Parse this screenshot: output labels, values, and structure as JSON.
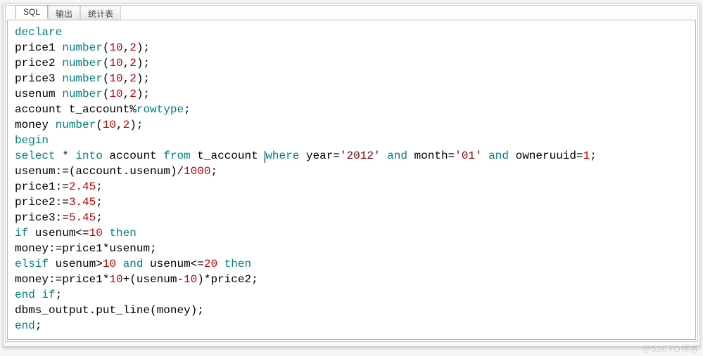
{
  "tabs": [
    {
      "label": "SQL",
      "active": true
    },
    {
      "label": "输出",
      "active": false
    },
    {
      "label": "统计表",
      "active": false
    }
  ],
  "code_tokens": [
    [
      {
        "t": "declare",
        "c": "kw"
      }
    ],
    [
      {
        "t": "price1 ",
        "c": "id"
      },
      {
        "t": "number",
        "c": "ty"
      },
      {
        "t": "(",
        "c": "punc"
      },
      {
        "t": "10",
        "c": "num"
      },
      {
        "t": ",",
        "c": "punc"
      },
      {
        "t": "2",
        "c": "num"
      },
      {
        "t": ");",
        "c": "punc"
      }
    ],
    [
      {
        "t": "price2 ",
        "c": "id"
      },
      {
        "t": "number",
        "c": "ty"
      },
      {
        "t": "(",
        "c": "punc"
      },
      {
        "t": "10",
        "c": "num"
      },
      {
        "t": ",",
        "c": "punc"
      },
      {
        "t": "2",
        "c": "num"
      },
      {
        "t": ");",
        "c": "punc"
      }
    ],
    [
      {
        "t": "price3 ",
        "c": "id"
      },
      {
        "t": "number",
        "c": "ty"
      },
      {
        "t": "(",
        "c": "punc"
      },
      {
        "t": "10",
        "c": "num"
      },
      {
        "t": ",",
        "c": "punc"
      },
      {
        "t": "2",
        "c": "num"
      },
      {
        "t": ");",
        "c": "punc"
      }
    ],
    [
      {
        "t": "usenum ",
        "c": "id"
      },
      {
        "t": "number",
        "c": "ty"
      },
      {
        "t": "(",
        "c": "punc"
      },
      {
        "t": "10",
        "c": "num"
      },
      {
        "t": ",",
        "c": "punc"
      },
      {
        "t": "2",
        "c": "num"
      },
      {
        "t": ");",
        "c": "punc"
      }
    ],
    [
      {
        "t": "account ",
        "c": "id"
      },
      {
        "t": "t_account",
        "c": "id"
      },
      {
        "t": "%",
        "c": "op"
      },
      {
        "t": "rowtype",
        "c": "ty"
      },
      {
        "t": ";",
        "c": "punc"
      }
    ],
    [
      {
        "t": "money ",
        "c": "id"
      },
      {
        "t": "number",
        "c": "ty"
      },
      {
        "t": "(",
        "c": "punc"
      },
      {
        "t": "10",
        "c": "num"
      },
      {
        "t": ",",
        "c": "punc"
      },
      {
        "t": "2",
        "c": "num"
      },
      {
        "t": ");",
        "c": "punc"
      }
    ],
    [
      {
        "t": "begin",
        "c": "kw"
      }
    ],
    [
      {
        "t": "select",
        "c": "kw"
      },
      {
        "t": " * ",
        "c": "id"
      },
      {
        "t": "into",
        "c": "kw"
      },
      {
        "t": " account ",
        "c": "id"
      },
      {
        "t": "from",
        "c": "kw"
      },
      {
        "t": " t_account ",
        "c": "id"
      },
      {
        "cursor": true
      },
      {
        "t": "where",
        "c": "kw"
      },
      {
        "t": " year=",
        "c": "id"
      },
      {
        "t": "'2012'",
        "c": "str"
      },
      {
        "t": " ",
        "c": "id"
      },
      {
        "t": "and",
        "c": "kw"
      },
      {
        "t": " month=",
        "c": "id"
      },
      {
        "t": "'01'",
        "c": "str"
      },
      {
        "t": " ",
        "c": "id"
      },
      {
        "t": "and",
        "c": "kw"
      },
      {
        "t": " owneruuid=",
        "c": "id"
      },
      {
        "t": "1",
        "c": "num"
      },
      {
        "t": ";",
        "c": "punc"
      }
    ],
    [
      {
        "t": "usenum:=(account.usenum)/",
        "c": "id"
      },
      {
        "t": "1000",
        "c": "num"
      },
      {
        "t": ";",
        "c": "punc"
      }
    ],
    [
      {
        "t": "price1:=",
        "c": "id"
      },
      {
        "t": "2.45",
        "c": "num"
      },
      {
        "t": ";",
        "c": "punc"
      }
    ],
    [
      {
        "t": "price2:=",
        "c": "id"
      },
      {
        "t": "3.45",
        "c": "num"
      },
      {
        "t": ";",
        "c": "punc"
      }
    ],
    [
      {
        "t": "price3:=",
        "c": "id"
      },
      {
        "t": "5.45",
        "c": "num"
      },
      {
        "t": ";",
        "c": "punc"
      }
    ],
    [
      {
        "t": "if",
        "c": "kw"
      },
      {
        "t": " usenum<=",
        "c": "id"
      },
      {
        "t": "10",
        "c": "num"
      },
      {
        "t": " ",
        "c": "id"
      },
      {
        "t": "then",
        "c": "kw"
      }
    ],
    [
      {
        "t": "money:=price1*usenum;",
        "c": "id"
      }
    ],
    [
      {
        "t": "elsif",
        "c": "kw"
      },
      {
        "t": " usenum>",
        "c": "id"
      },
      {
        "t": "10",
        "c": "num"
      },
      {
        "t": " ",
        "c": "id"
      },
      {
        "t": "and",
        "c": "kw"
      },
      {
        "t": " usenum<=",
        "c": "id"
      },
      {
        "t": "20",
        "c": "num"
      },
      {
        "t": " ",
        "c": "id"
      },
      {
        "t": "then",
        "c": "kw"
      }
    ],
    [
      {
        "t": "money:=price1*",
        "c": "id"
      },
      {
        "t": "10",
        "c": "num"
      },
      {
        "t": "+(usenum-",
        "c": "id"
      },
      {
        "t": "10",
        "c": "num"
      },
      {
        "t": ")*price2;",
        "c": "id"
      }
    ],
    [
      {
        "t": "end",
        "c": "kw"
      },
      {
        "t": " ",
        "c": "id"
      },
      {
        "t": "if",
        "c": "kw"
      },
      {
        "t": ";",
        "c": "punc"
      }
    ],
    [
      {
        "t": "dbms_output.put_line(money);",
        "c": "id"
      }
    ],
    [
      {
        "t": "end",
        "c": "kw"
      },
      {
        "t": ";",
        "c": "punc"
      }
    ]
  ],
  "watermark": "@51CTO博客"
}
